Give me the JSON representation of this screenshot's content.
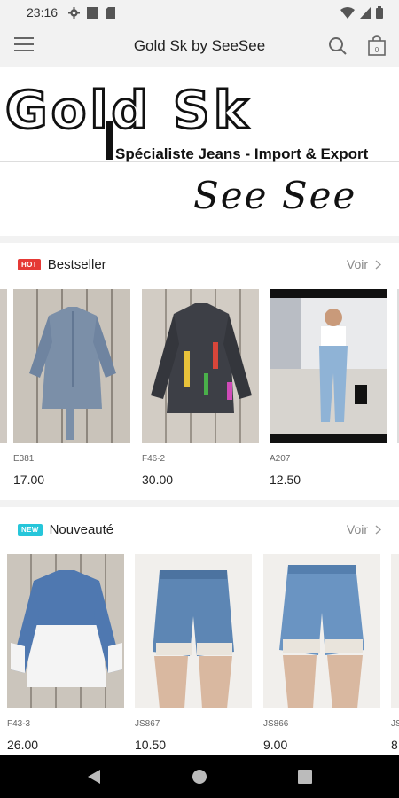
{
  "status_bar": {
    "time": "23:16"
  },
  "app_bar": {
    "title": "Gold Sk by SeeSee",
    "cart_count": "0"
  },
  "banner": {
    "logo_text": "Gold Sk",
    "tagline": "Spécialiste Jeans - Import & Export",
    "script_text": "See See"
  },
  "sections": [
    {
      "badge": "HOT",
      "title": "Bestseller",
      "see_all": "Voir",
      "products": [
        {
          "code": "E381",
          "price": "17.00"
        },
        {
          "code": "F46-2",
          "price": "30.00"
        },
        {
          "code": "A207",
          "price": "12.50"
        }
      ]
    },
    {
      "badge": "NEW",
      "title": "Nouveauté",
      "see_all": "Voir",
      "products": [
        {
          "code": "F43-3",
          "price": "26.00"
        },
        {
          "code": "JS867",
          "price": "10.50"
        },
        {
          "code": "JS866",
          "price": "9.00"
        },
        {
          "code": "JS",
          "price": "8"
        }
      ]
    }
  ],
  "colors": {
    "hot_badge": "#e53935",
    "new_badge": "#26c6da",
    "bar_bg": "#f2f2f2"
  },
  "icons": [
    "gear-icon",
    "square-icon",
    "sd-card-icon",
    "wifi-icon",
    "signal-icon",
    "battery-icon",
    "hamburger-menu-icon",
    "search-icon",
    "shopping-bag-icon",
    "chevron-right-icon",
    "back-icon",
    "home-icon",
    "recents-icon"
  ]
}
